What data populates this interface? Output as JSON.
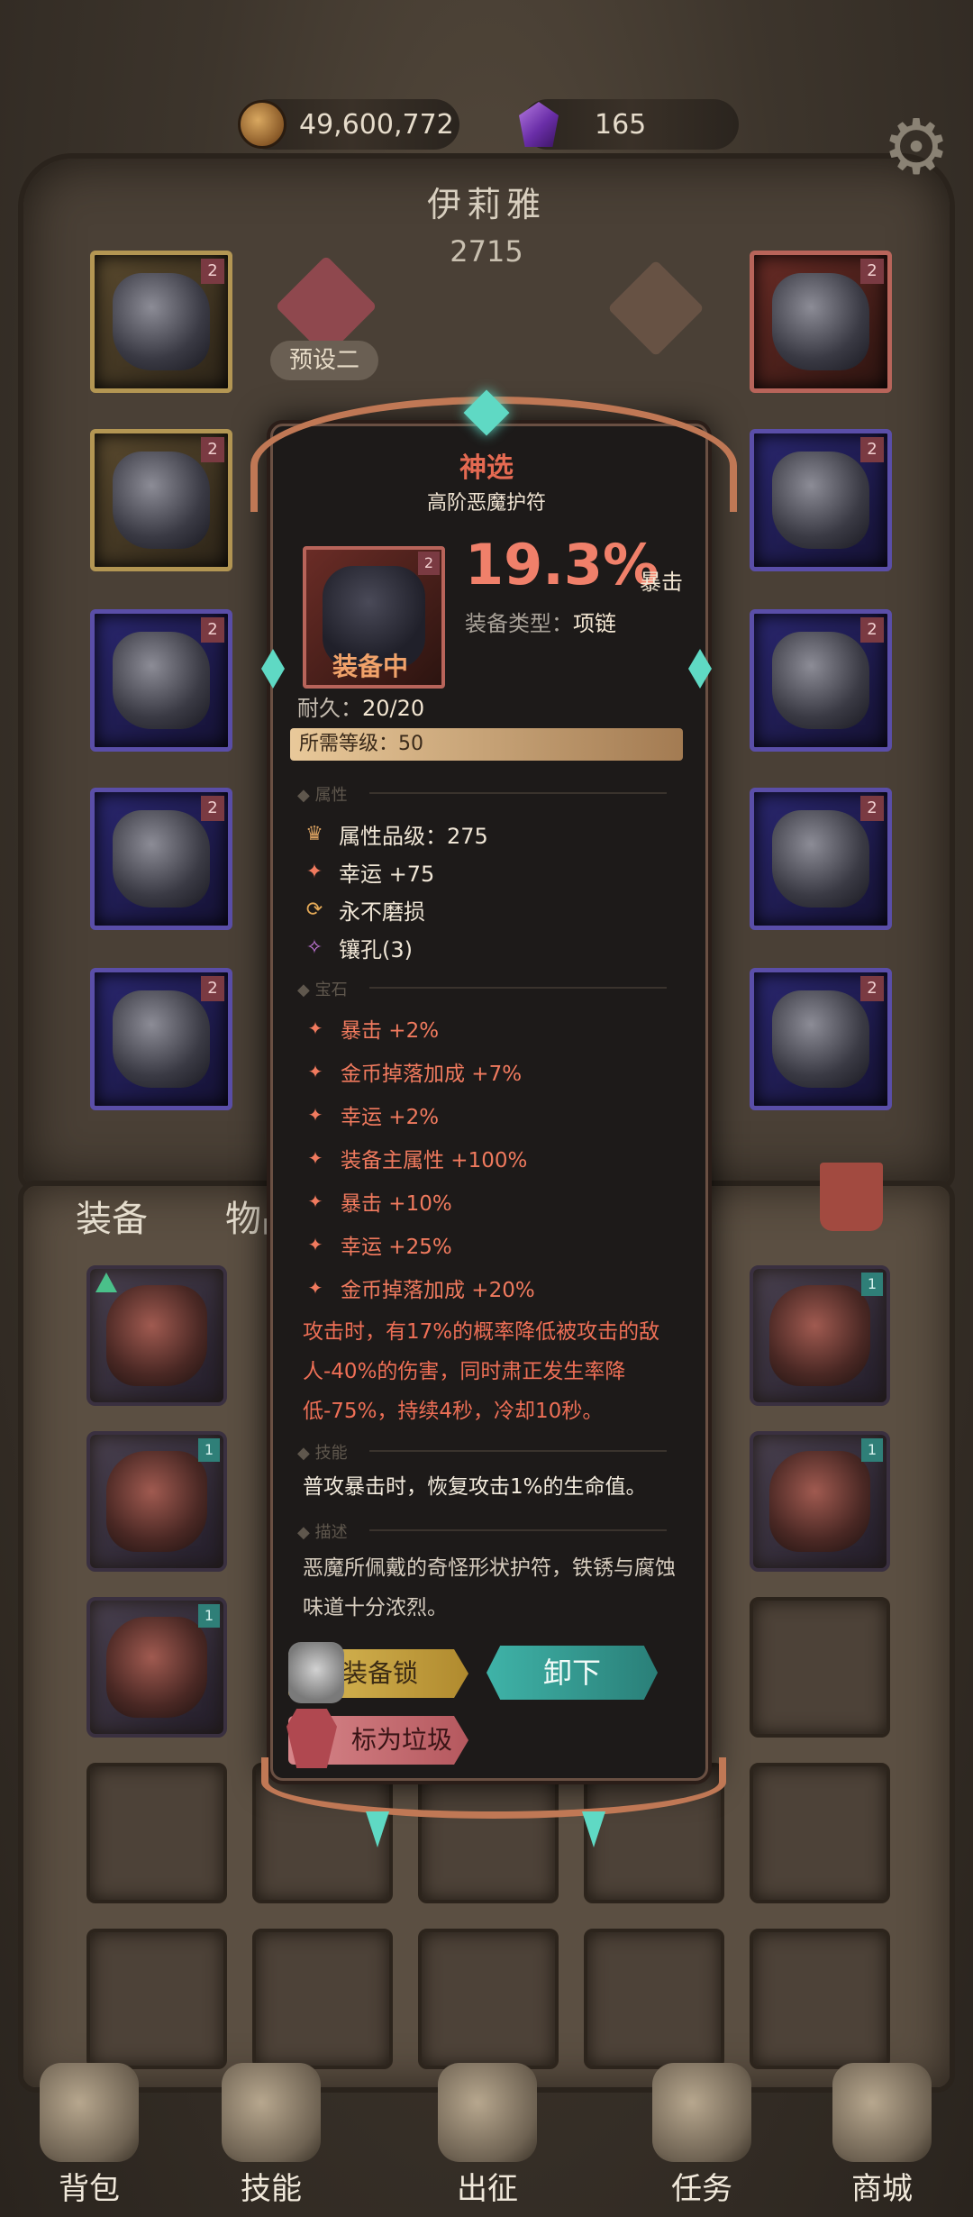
{
  "topbar": {
    "gold_amount": "49,600,772",
    "gem_amount": "165",
    "settings_icon": "gear-icon"
  },
  "character": {
    "name": "伊莉雅",
    "score": "2715",
    "preset_label": "预设二"
  },
  "slot_badge": "2",
  "bag": {
    "tab_equipment": "装备",
    "tab_items": "物品",
    "tier_badge": "1"
  },
  "tooltip": {
    "title": "神选",
    "subtitle": "高阶恶魔护符",
    "item_badge": "2",
    "equipped_label": "装备中",
    "main_stat_value": "19.3%",
    "main_stat_name": "暴击",
    "type_label": "装备类型：",
    "type_value": "项链",
    "durability_label": "耐久：",
    "durability_value": "20/20",
    "level_req_label": "所需等级：",
    "level_req_value": "50",
    "section_attributes": "属性",
    "attributes": [
      {
        "icon": "crown-icon",
        "text": "属性品级：275"
      },
      {
        "icon": "luck-icon",
        "text": "幸运 +75"
      },
      {
        "icon": "refresh-icon",
        "text": "永不磨损"
      },
      {
        "icon": "socket-icon",
        "text": "镶孔(3)"
      }
    ],
    "section_gems": "宝石",
    "gems": [
      "暴击 +2%",
      "金币掉落加成 +7%",
      "幸运 +2%",
      "装备主属性 +100%",
      "暴击 +10%",
      "幸运 +25%",
      "金币掉落加成 +20%"
    ],
    "special_effect": "攻击时，有17%的概率降低被攻击的敌人-40%的伤害，同时肃正发生率降低-75%，持续4秒，冷却10秒。",
    "section_skills": "技能",
    "skill_text": "普攻暴击时，恢复攻击1%的生命值。",
    "section_description": "描述",
    "description": "恶魔所佩戴的奇怪形状护符，铁锈与腐蚀味道十分浓烈。",
    "btn_lock": "装备锁",
    "btn_unequip": "卸下",
    "btn_trash": "标为垃圾"
  },
  "nav": [
    {
      "label": "背包",
      "icon": "bag-icon"
    },
    {
      "label": "技能",
      "icon": "skill-icon"
    },
    {
      "label": "出征",
      "icon": "sword-icon"
    },
    {
      "label": "任务",
      "icon": "quest-icon"
    },
    {
      "label": "商城",
      "icon": "shop-icon"
    }
  ],
  "colors": {
    "accent_red": "#f0806a",
    "accent_teal": "#3fb3a8",
    "gold": "#dcbc58"
  }
}
